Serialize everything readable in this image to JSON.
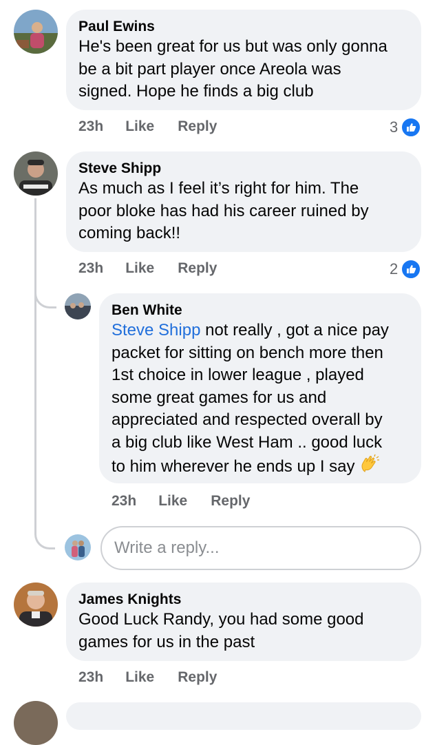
{
  "comments": [
    {
      "name": "Paul Ewins",
      "text_lines": [
        "He's been great for us but was only gonna",
        "be a bit part player once Areola was",
        "signed. Hope he finds a big club"
      ],
      "time": "23h",
      "like": "Like",
      "reply": "Reply",
      "reactions": "3"
    },
    {
      "name": "Steve Shipp",
      "text_lines": [
        "As much as I feel it’s right for him. The",
        "poor bloke has had his career ruined by",
        "coming back!!"
      ],
      "time": "23h",
      "like": "Like",
      "reply": "Reply",
      "reactions": "2"
    },
    {
      "name": "James Knights",
      "text_lines": [
        "Good Luck Randy, you had some good",
        "games for us in the past"
      ],
      "time": "23h",
      "like": "Like",
      "reply": "Reply"
    }
  ],
  "reply": {
    "name": "Ben White",
    "mention": "Steve Shipp",
    "first_line_rest": " not really , got a nice pay",
    "text_lines": [
      "packet for sitting on bench more then",
      "1st choice in lower league , played",
      "some great games for us and",
      "appreciated and respected overall by",
      "a big club like West Ham .. good luck",
      "to him wherever he ends up I say"
    ],
    "emoji": "clapping-hands",
    "time": "23h",
    "like": "Like",
    "reply": "Reply"
  },
  "reply_input": {
    "placeholder": "Write a reply..."
  },
  "colors": {
    "like_badge": "#1877f2",
    "mention": "#216fdb",
    "bubble": "#f0f2f5",
    "meta": "#65676b"
  }
}
